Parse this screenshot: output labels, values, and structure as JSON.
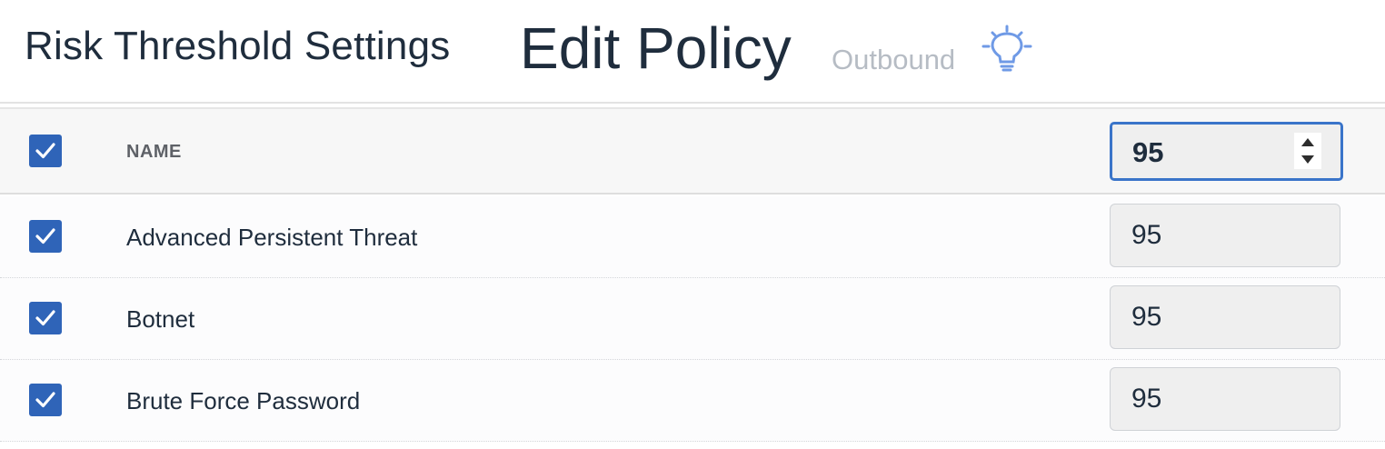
{
  "header": {
    "section_title": "Risk Threshold Settings",
    "page_title": "Edit Policy",
    "direction_label": "Outbound",
    "hint_icon": "lightbulb-icon"
  },
  "colors": {
    "accent": "#2f64b8",
    "focus_border": "#3a74c9",
    "text": "#1f2d3d",
    "muted": "#b6bcc4",
    "hint_icon": "#6f9ae6"
  },
  "table": {
    "select_all_checked": true,
    "column_name_header": "NAME",
    "bulk_threshold_value": "95",
    "rows": [
      {
        "checked": true,
        "name": "Advanced Persistent Threat",
        "threshold": "95"
      },
      {
        "checked": true,
        "name": "Botnet",
        "threshold": "95"
      },
      {
        "checked": true,
        "name": "Brute Force Password",
        "threshold": "95"
      }
    ]
  }
}
